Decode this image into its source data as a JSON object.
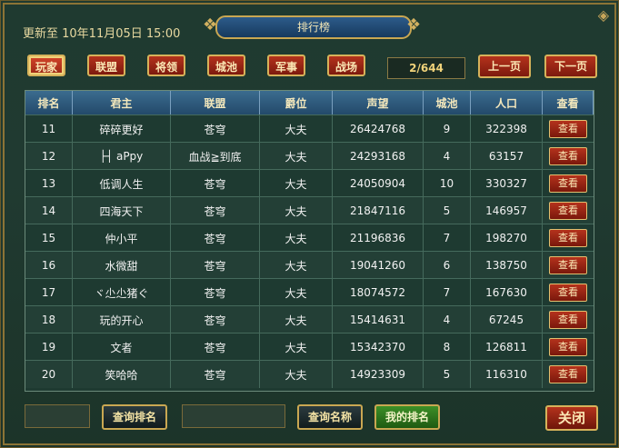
{
  "update_text": "更新至 10年11月05日 15:00",
  "title": "排行榜",
  "categories": [
    "玩家",
    "联盟",
    "将领",
    "城池",
    "军事",
    "战场"
  ],
  "page_indicator": "2/644",
  "prev_page": "上一页",
  "next_page": "下一页",
  "columns": [
    "排名",
    "君主",
    "联盟",
    "爵位",
    "声望",
    "城池",
    "人口",
    "查看"
  ],
  "rows": [
    {
      "rank": "11",
      "lord": "碎碎更好",
      "alliance": "苍穹",
      "title": "大夫",
      "prestige": "26424768",
      "cities": "9",
      "population": "322398",
      "view": "查看"
    },
    {
      "rank": "12",
      "lord": "├┤ aPpy",
      "alliance": "血战≧到底",
      "title": "大夫",
      "prestige": "24293168",
      "cities": "4",
      "population": "63157",
      "view": "查看"
    },
    {
      "rank": "13",
      "lord": "低调人生",
      "alliance": "苍穹",
      "title": "大夫",
      "prestige": "24050904",
      "cities": "10",
      "population": "330327",
      "view": "查看"
    },
    {
      "rank": "14",
      "lord": "四海天下",
      "alliance": "苍穹",
      "title": "大夫",
      "prestige": "21847116",
      "cities": "5",
      "population": "146957",
      "view": "查看"
    },
    {
      "rank": "15",
      "lord": "仲小平",
      "alliance": "苍穹",
      "title": "大夫",
      "prestige": "21196836",
      "cities": "7",
      "population": "198270",
      "view": "查看"
    },
    {
      "rank": "16",
      "lord": "水微甜",
      "alliance": "苍穹",
      "title": "大夫",
      "prestige": "19041260",
      "cities": "6",
      "population": "138750",
      "view": "查看"
    },
    {
      "rank": "17",
      "lord": "ヾ尐尐猪ぐ",
      "alliance": "苍穹",
      "title": "大夫",
      "prestige": "18074572",
      "cities": "7",
      "population": "167630",
      "view": "查看"
    },
    {
      "rank": "18",
      "lord": "玩的开心",
      "alliance": "苍穹",
      "title": "大夫",
      "prestige": "15414631",
      "cities": "4",
      "population": "67245",
      "view": "查看"
    },
    {
      "rank": "19",
      "lord": "文者",
      "alliance": "苍穹",
      "title": "大夫",
      "prestige": "15342370",
      "cities": "8",
      "population": "126811",
      "view": "查看"
    },
    {
      "rank": "20",
      "lord": "笑哈哈",
      "alliance": "苍穹",
      "title": "大夫",
      "prestige": "14923309",
      "cities": "5",
      "population": "116310",
      "view": "查看"
    }
  ],
  "query_rank_button": "查询排名",
  "query_name_button": "查询名称",
  "my_rank_button": "我的排名",
  "close_button": "关闭",
  "colors": {
    "accent_red": "#b4321c",
    "gold_border": "#d6b25a",
    "header_blue": "#3b6c8f",
    "panel_green": "#1e3a31"
  }
}
